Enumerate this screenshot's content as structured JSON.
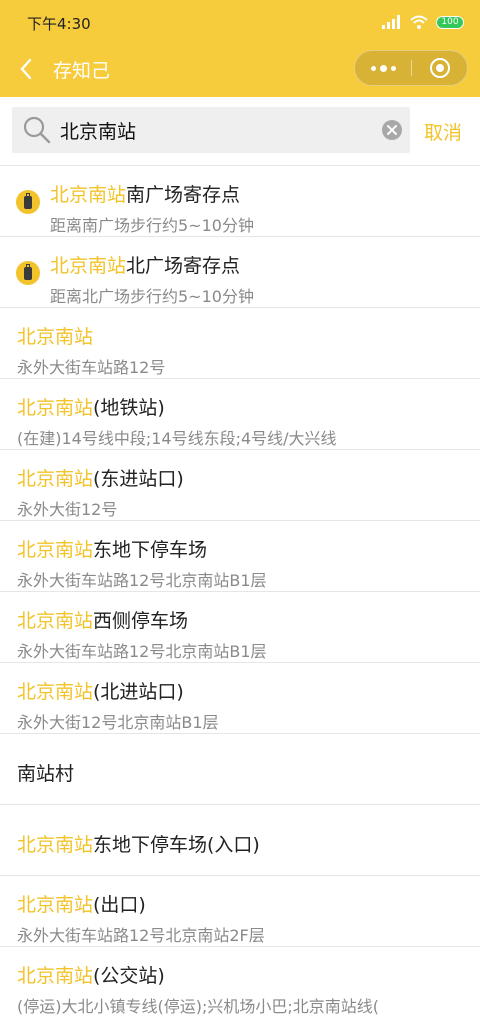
{
  "status_bar": {
    "time": "下午4:30",
    "battery": "100"
  },
  "nav": {
    "title": "存知己"
  },
  "search": {
    "query": "北京南站",
    "cancel_label": "取消"
  },
  "results": [
    {
      "highlight": "北京南站",
      "rest": "南广场寄存点",
      "subtitle": "距离南广场步行约5~10分钟",
      "icon": "luggage-icon"
    },
    {
      "highlight": "北京南站",
      "rest": "北广场寄存点",
      "subtitle": "距离北广场步行约5~10分钟",
      "icon": "luggage-icon"
    },
    {
      "highlight": "北京南站",
      "rest": "",
      "subtitle": "永外大街车站路12号"
    },
    {
      "highlight": "北京南站",
      "rest": "(地铁站)",
      "subtitle": "(在建)14号线中段;14号线东段;4号线/大兴线"
    },
    {
      "highlight": "北京南站",
      "rest": "(东进站口)",
      "subtitle": "永外大街12号"
    },
    {
      "highlight": "北京南站",
      "rest": "东地下停车场",
      "subtitle": "永外大街车站路12号北京南站B1层"
    },
    {
      "highlight": "北京南站",
      "rest": "西侧停车场",
      "subtitle": "永外大街车站路12号北京南站B1层"
    },
    {
      "highlight": "北京南站",
      "rest": "(北进站口)",
      "subtitle": "永外大街12号北京南站B1层"
    },
    {
      "highlight": "",
      "rest": "南站村",
      "subtitle": ""
    },
    {
      "highlight": "北京南站",
      "rest": "东地下停车场(入口)",
      "subtitle": ""
    },
    {
      "highlight": "北京南站",
      "rest": "(出口)",
      "subtitle": "永外大街车站路12号北京南站2F层"
    },
    {
      "highlight": "北京南站",
      "rest": "(公交站)",
      "subtitle": "(停运)大北小镇专线(停运);兴机场小巴;北京南站线("
    }
  ],
  "colors": {
    "accent": "#f6cb3c",
    "highlight_text": "#f2c32a",
    "subtitle_text": "#8a8a8a"
  }
}
